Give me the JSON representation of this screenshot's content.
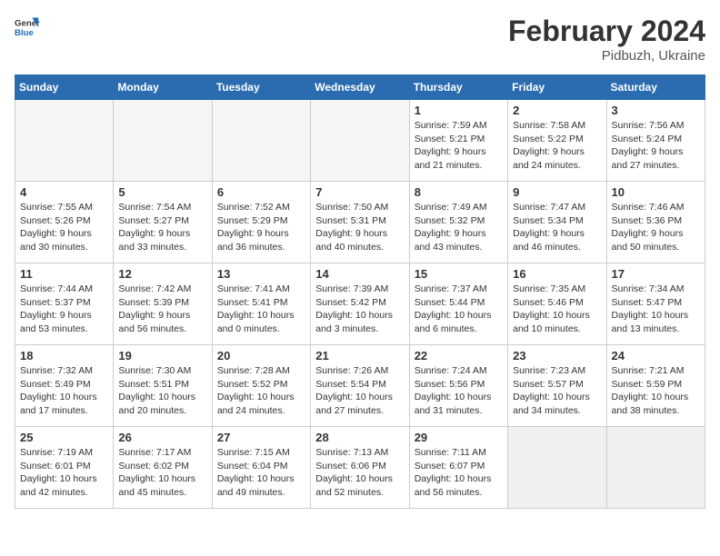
{
  "header": {
    "logo_general": "General",
    "logo_blue": "Blue",
    "month_title": "February 2024",
    "location": "Pidbuzh, Ukraine"
  },
  "weekdays": [
    "Sunday",
    "Monday",
    "Tuesday",
    "Wednesday",
    "Thursday",
    "Friday",
    "Saturday"
  ],
  "weeks": [
    [
      {
        "day": "",
        "detail": "",
        "empty": true
      },
      {
        "day": "",
        "detail": "",
        "empty": true
      },
      {
        "day": "",
        "detail": "",
        "empty": true
      },
      {
        "day": "",
        "detail": "",
        "empty": true
      },
      {
        "day": "1",
        "detail": "Sunrise: 7:59 AM\nSunset: 5:21 PM\nDaylight: 9 hours\nand 21 minutes."
      },
      {
        "day": "2",
        "detail": "Sunrise: 7:58 AM\nSunset: 5:22 PM\nDaylight: 9 hours\nand 24 minutes."
      },
      {
        "day": "3",
        "detail": "Sunrise: 7:56 AM\nSunset: 5:24 PM\nDaylight: 9 hours\nand 27 minutes."
      }
    ],
    [
      {
        "day": "4",
        "detail": "Sunrise: 7:55 AM\nSunset: 5:26 PM\nDaylight: 9 hours\nand 30 minutes."
      },
      {
        "day": "5",
        "detail": "Sunrise: 7:54 AM\nSunset: 5:27 PM\nDaylight: 9 hours\nand 33 minutes."
      },
      {
        "day": "6",
        "detail": "Sunrise: 7:52 AM\nSunset: 5:29 PM\nDaylight: 9 hours\nand 36 minutes."
      },
      {
        "day": "7",
        "detail": "Sunrise: 7:50 AM\nSunset: 5:31 PM\nDaylight: 9 hours\nand 40 minutes."
      },
      {
        "day": "8",
        "detail": "Sunrise: 7:49 AM\nSunset: 5:32 PM\nDaylight: 9 hours\nand 43 minutes."
      },
      {
        "day": "9",
        "detail": "Sunrise: 7:47 AM\nSunset: 5:34 PM\nDaylight: 9 hours\nand 46 minutes."
      },
      {
        "day": "10",
        "detail": "Sunrise: 7:46 AM\nSunset: 5:36 PM\nDaylight: 9 hours\nand 50 minutes."
      }
    ],
    [
      {
        "day": "11",
        "detail": "Sunrise: 7:44 AM\nSunset: 5:37 PM\nDaylight: 9 hours\nand 53 minutes."
      },
      {
        "day": "12",
        "detail": "Sunrise: 7:42 AM\nSunset: 5:39 PM\nDaylight: 9 hours\nand 56 minutes."
      },
      {
        "day": "13",
        "detail": "Sunrise: 7:41 AM\nSunset: 5:41 PM\nDaylight: 10 hours\nand 0 minutes."
      },
      {
        "day": "14",
        "detail": "Sunrise: 7:39 AM\nSunset: 5:42 PM\nDaylight: 10 hours\nand 3 minutes."
      },
      {
        "day": "15",
        "detail": "Sunrise: 7:37 AM\nSunset: 5:44 PM\nDaylight: 10 hours\nand 6 minutes."
      },
      {
        "day": "16",
        "detail": "Sunrise: 7:35 AM\nSunset: 5:46 PM\nDaylight: 10 hours\nand 10 minutes."
      },
      {
        "day": "17",
        "detail": "Sunrise: 7:34 AM\nSunset: 5:47 PM\nDaylight: 10 hours\nand 13 minutes."
      }
    ],
    [
      {
        "day": "18",
        "detail": "Sunrise: 7:32 AM\nSunset: 5:49 PM\nDaylight: 10 hours\nand 17 minutes."
      },
      {
        "day": "19",
        "detail": "Sunrise: 7:30 AM\nSunset: 5:51 PM\nDaylight: 10 hours\nand 20 minutes."
      },
      {
        "day": "20",
        "detail": "Sunrise: 7:28 AM\nSunset: 5:52 PM\nDaylight: 10 hours\nand 24 minutes."
      },
      {
        "day": "21",
        "detail": "Sunrise: 7:26 AM\nSunset: 5:54 PM\nDaylight: 10 hours\nand 27 minutes."
      },
      {
        "day": "22",
        "detail": "Sunrise: 7:24 AM\nSunset: 5:56 PM\nDaylight: 10 hours\nand 31 minutes."
      },
      {
        "day": "23",
        "detail": "Sunrise: 7:23 AM\nSunset: 5:57 PM\nDaylight: 10 hours\nand 34 minutes."
      },
      {
        "day": "24",
        "detail": "Sunrise: 7:21 AM\nSunset: 5:59 PM\nDaylight: 10 hours\nand 38 minutes."
      }
    ],
    [
      {
        "day": "25",
        "detail": "Sunrise: 7:19 AM\nSunset: 6:01 PM\nDaylight: 10 hours\nand 42 minutes."
      },
      {
        "day": "26",
        "detail": "Sunrise: 7:17 AM\nSunset: 6:02 PM\nDaylight: 10 hours\nand 45 minutes."
      },
      {
        "day": "27",
        "detail": "Sunrise: 7:15 AM\nSunset: 6:04 PM\nDaylight: 10 hours\nand 49 minutes."
      },
      {
        "day": "28",
        "detail": "Sunrise: 7:13 AM\nSunset: 6:06 PM\nDaylight: 10 hours\nand 52 minutes."
      },
      {
        "day": "29",
        "detail": "Sunrise: 7:11 AM\nSunset: 6:07 PM\nDaylight: 10 hours\nand 56 minutes."
      },
      {
        "day": "",
        "detail": "",
        "empty": true,
        "shaded": true
      },
      {
        "day": "",
        "detail": "",
        "empty": true,
        "shaded": true
      }
    ]
  ]
}
